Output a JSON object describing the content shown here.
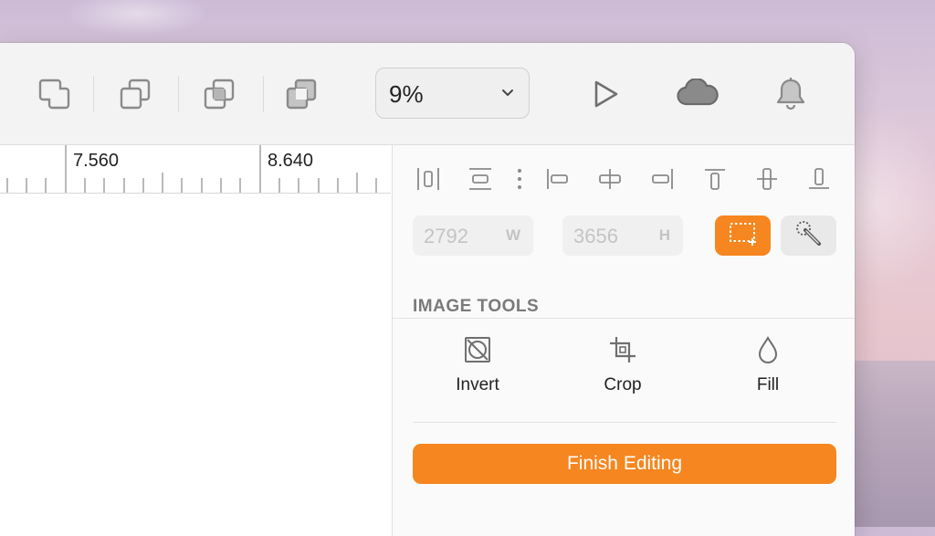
{
  "toolbar": {
    "icons": [
      "union-icon",
      "subtract-icon",
      "intersect-icon",
      "difference-icon"
    ],
    "zoom": {
      "value": "9%"
    },
    "actions": [
      "play-icon",
      "cloud-icon",
      "bell-icon"
    ]
  },
  "ruler": {
    "labels": [
      "7.560",
      "8.640"
    ]
  },
  "inspector": {
    "width": {
      "placeholder": "2792",
      "unit": "W"
    },
    "height": {
      "placeholder": "3656",
      "unit": "H"
    },
    "image_tools": {
      "title": "IMAGE TOOLS",
      "tools": [
        {
          "label": "Invert",
          "icon": "invert-icon"
        },
        {
          "label": "Crop",
          "icon": "crop-icon"
        },
        {
          "label": "Fill",
          "icon": "drop-icon"
        }
      ]
    },
    "finish_label": "Finish Editing"
  },
  "colors": {
    "accent": "#f6861f",
    "toolbar_bg": "#f3f3f3",
    "icon_gray": "#8a8a8a"
  }
}
